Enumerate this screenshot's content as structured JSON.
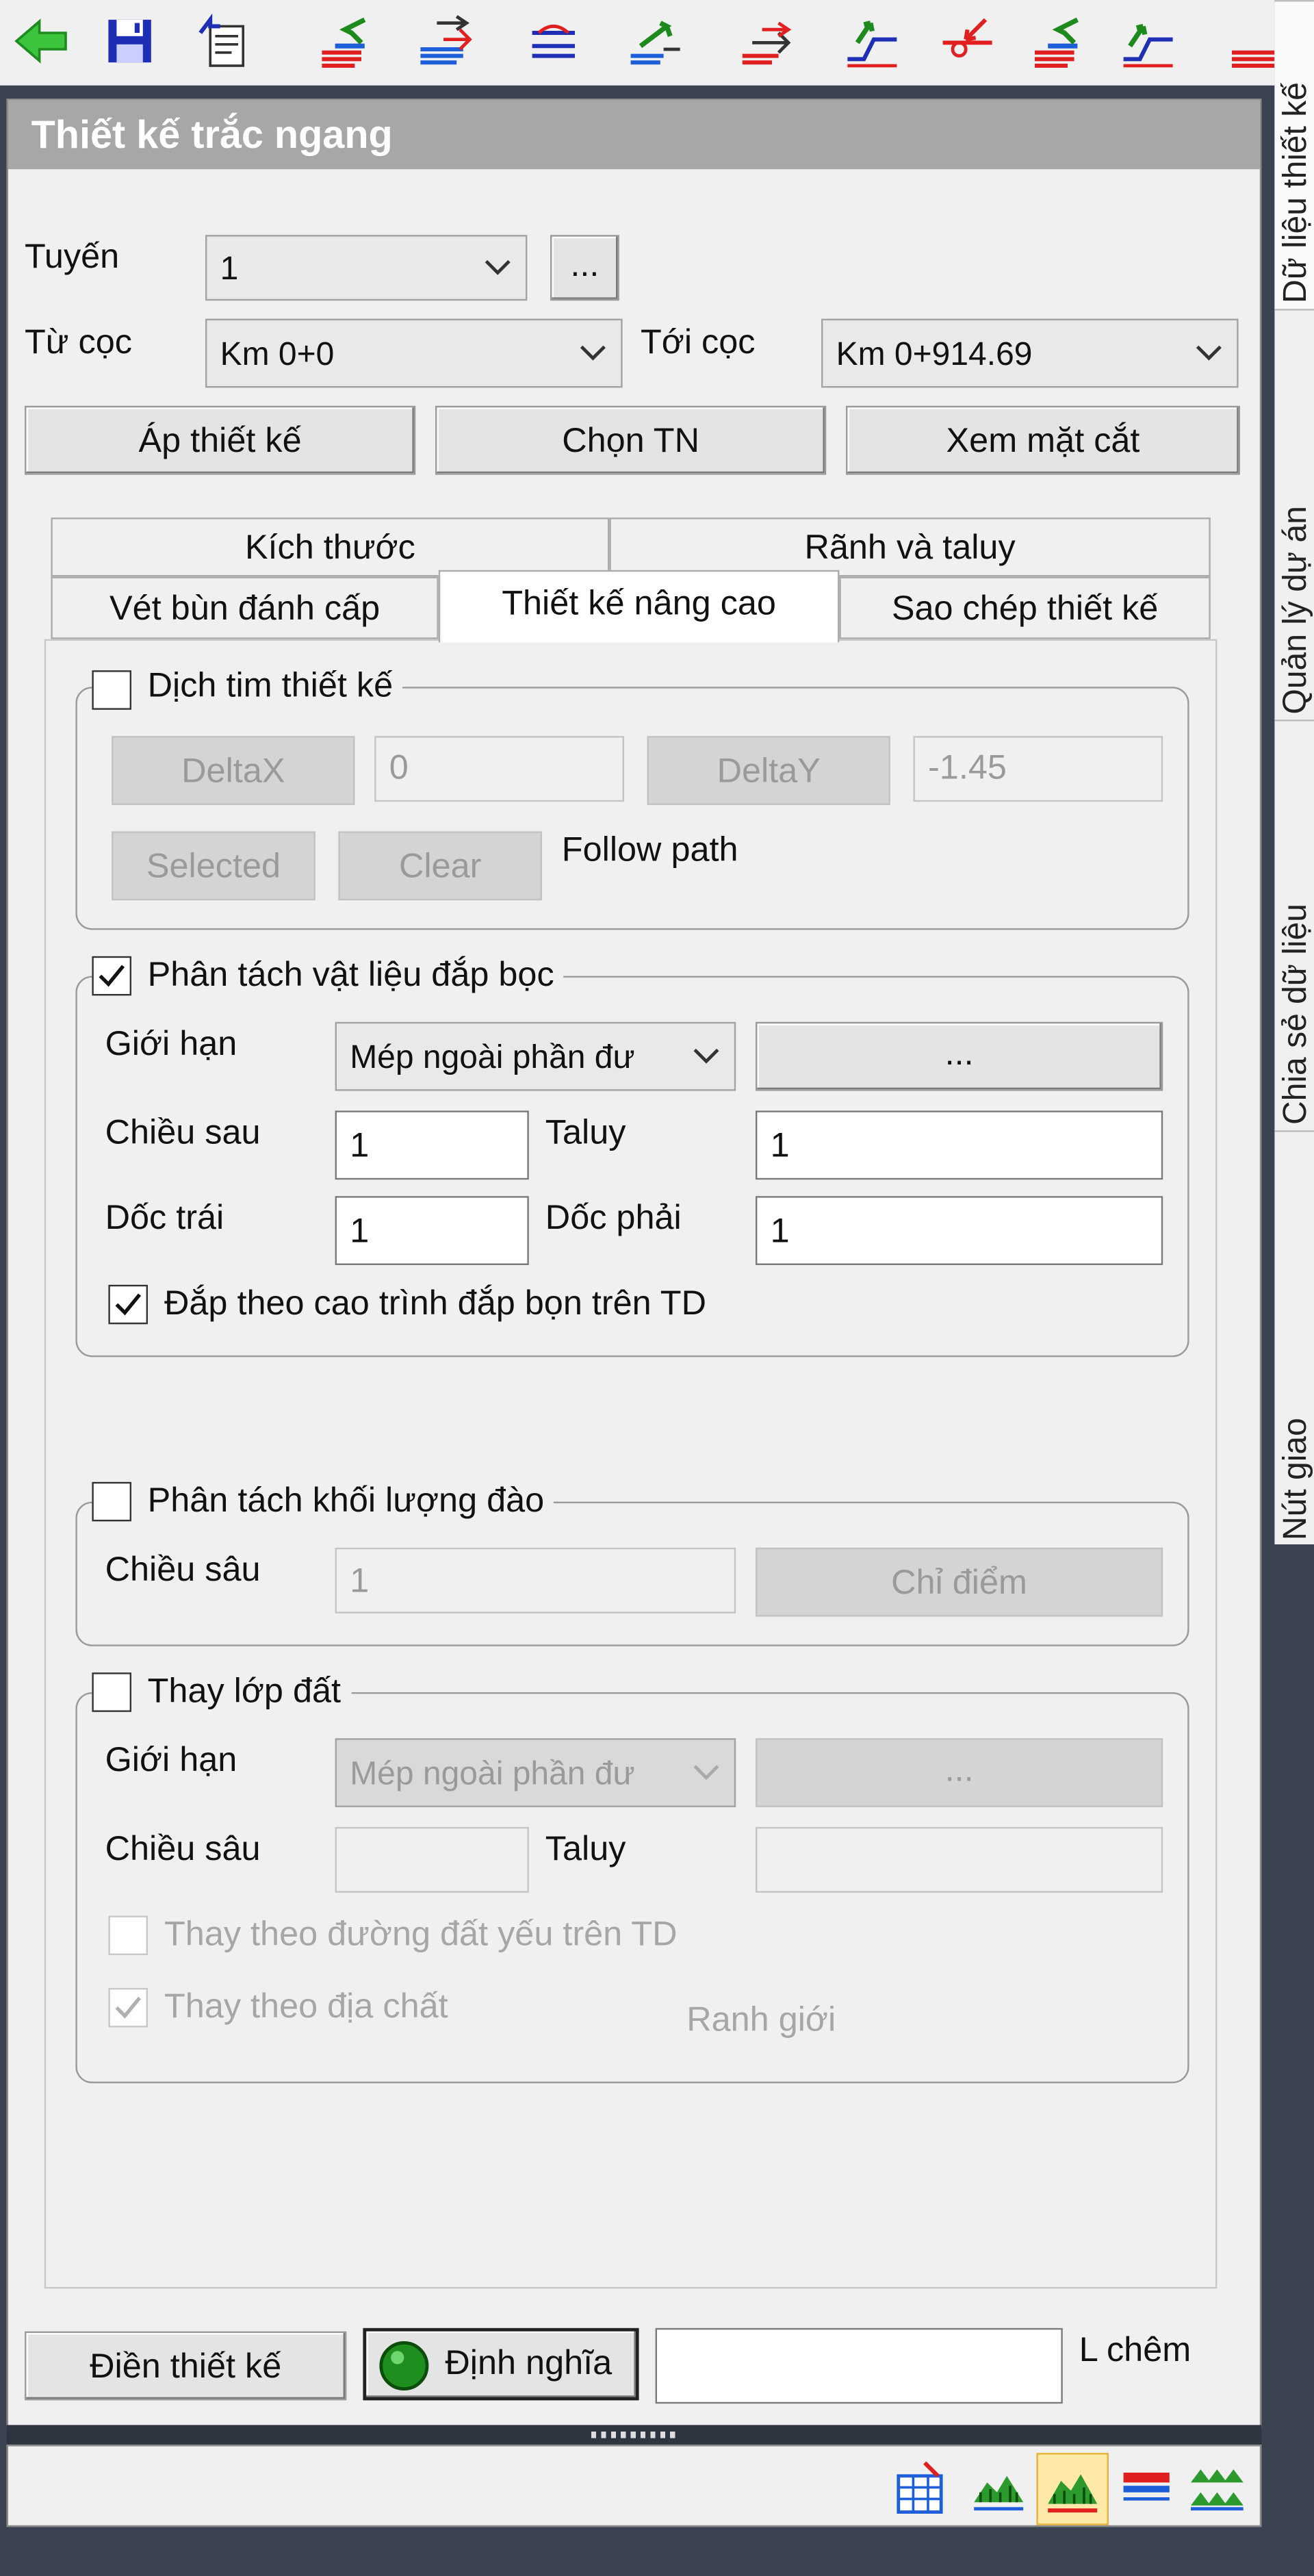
{
  "toolbar": {
    "icons": [
      "back-arrow-icon",
      "save-icon",
      "paste-icon",
      "layer-swap-icon",
      "layer-move-icon",
      "line-offset-icon",
      "layer-up-icon",
      "arrow-layer-icon",
      "slope-up-icon",
      "intersect-icon",
      "layer-swap-2-icon",
      "slope-icon",
      "layer-more-icon"
    ]
  },
  "dock": {
    "tabs": [
      "Dữ liệu thiết kế",
      "Quản lý dự án",
      "Chia sẻ dữ liệu",
      "Nút giao"
    ]
  },
  "panel": {
    "title": "Thiết kế trắc ngang",
    "route_label": "Tuyến",
    "route_value": "1",
    "route_more": "...",
    "from_label": "Từ cọc",
    "from_value": "Km 0+0",
    "to_label": "Tới cọc",
    "to_value": "Km 0+914.69",
    "btn_apply": "Áp thiết kế",
    "btn_choose": "Chọn TN",
    "btn_view": "Xem mặt cắt"
  },
  "tabs": {
    "row1": [
      "Kích thước",
      "Rãnh và taluy"
    ],
    "row2": [
      "Vét bùn đánh cấp",
      "Thiết kế nâng cao",
      "Sao chép thiết kế"
    ],
    "active": "Thiết kế nâng cao"
  },
  "shift": {
    "title": "Dịch tim thiết kế",
    "checked": false,
    "deltax_label": "DeltaX",
    "deltax_value": "0",
    "deltay_label": "DeltaY",
    "deltay_value": "-1.45",
    "selected": "Selected",
    "clear": "Clear",
    "follow": "Follow path"
  },
  "fill": {
    "title": "Phân tách vật liệu đắp bọc",
    "checked": true,
    "limit_label": "Giới hạn",
    "limit_value": "Mép ngoài phần đư",
    "limit_more": "...",
    "depth_label": "Chiều sau",
    "depth_value": "1",
    "taluy_label": "Taluy",
    "taluy_value": "1",
    "left_label": "Dốc trái",
    "left_value": "1",
    "right_label": "Dốc phải",
    "right_value": "1",
    "option": "Đắp theo cao trình đắp bọn trên TD",
    "option_checked": true
  },
  "cut": {
    "title": "Phân tách khối lượng đào",
    "checked": false,
    "depth_label": "Chiều sâu",
    "depth_value": "1",
    "pick_button": "Chỉ điểm"
  },
  "soil": {
    "title": "Thay lớp đất",
    "checked": false,
    "limit_label": "Giới hạn",
    "limit_value": "Mép ngoài phần đư",
    "limit_more": "...",
    "depth_label": "Chiều sâu",
    "depth_value": "",
    "taluy_label": "Taluy",
    "taluy_value": "",
    "weak_option": "Thay theo đường đất yếu trên TD",
    "weak_checked": false,
    "geo_option": "Thay theo địa chất",
    "geo_checked": true,
    "boundary": "Ranh giới"
  },
  "bottom": {
    "fill_button": "Điền thiết kế",
    "define_button": "Định nghĩa",
    "l_value": "",
    "l_label": "L chêm"
  },
  "statusbar": {
    "icons": [
      "table-grid-icon",
      "terrain-icon",
      "terrain-active-icon",
      "road-section-icon",
      "multi-terrain-icon"
    ]
  },
  "colors": {
    "accent_green": "#2d9a2d",
    "title_bar": "#a7a7a7",
    "dock": "#3b4250"
  }
}
